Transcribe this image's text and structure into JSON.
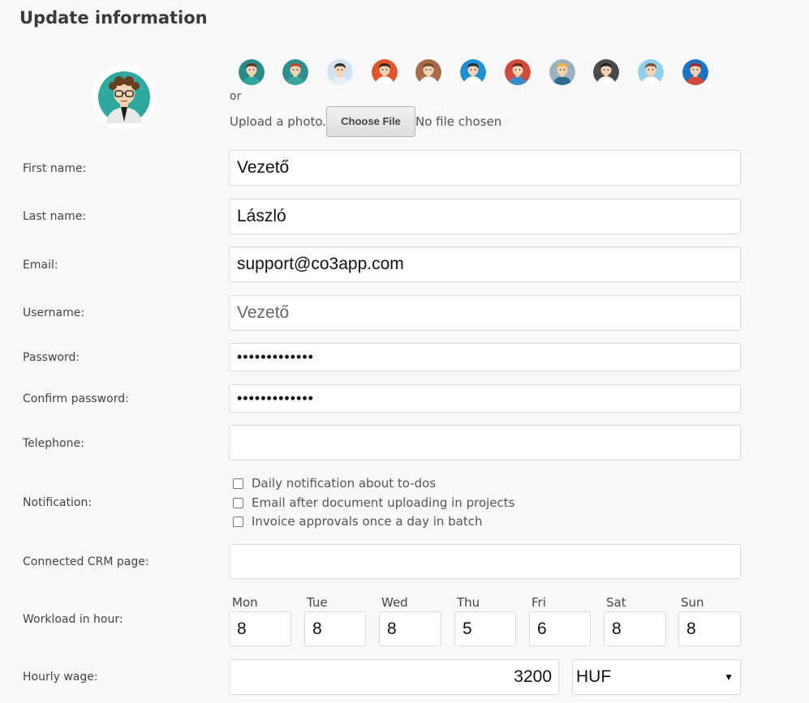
{
  "page": {
    "title": "Update information"
  },
  "avatars": {
    "current": "user-avatar",
    "options": [
      {
        "name": "avatar-man-glasses-teal",
        "bg": "#2a8a8a",
        "hair": "#5b3a1e",
        "shirt": "#2fa8a0"
      },
      {
        "name": "avatar-woman-redhead",
        "bg": "#2f8f8f",
        "hair": "#b8472c",
        "shirt": "#3aa59d"
      },
      {
        "name": "avatar-man-bald-beard",
        "bg": "#cfe3f3",
        "hair": "#2b2b2b",
        "shirt": "#e8eef4"
      },
      {
        "name": "avatar-man-red-bg",
        "bg": "#e0552e",
        "hair": "#3a2414",
        "shirt": "#ffffff"
      },
      {
        "name": "avatar-man-brown-bg",
        "bg": "#a76b4a",
        "hair": "#6a4a2e",
        "shirt": "#ffffff"
      },
      {
        "name": "avatar-man-blue-bg",
        "bg": "#1e8fd3",
        "hair": "#2a2a2a",
        "shirt": "#ffffff"
      },
      {
        "name": "avatar-woman-red-bg",
        "bg": "#d24a3a",
        "hair": "#6b2a16",
        "shirt": "#3a8cc9"
      },
      {
        "name": "avatar-woman-blonde",
        "bg": "#9ab2bf",
        "hair": "#f0b43a",
        "shirt": "#2c6d8f"
      },
      {
        "name": "avatar-man-dark-bg",
        "bg": "#4a4a4a",
        "hair": "#222222",
        "shirt": "#ffffff"
      },
      {
        "name": "avatar-man-lightblue-bg",
        "bg": "#8fd0ee",
        "hair": "#7a5232",
        "shirt": "#ffffff"
      },
      {
        "name": "avatar-woman-blue-bg",
        "bg": "#1d73c4",
        "hair": "#a5231f",
        "shirt": "#d34a3a"
      }
    ]
  },
  "photo": {
    "or_text": "or",
    "upload_label": "Upload a photo...",
    "choose_button": "Choose File",
    "no_file": "No file chosen"
  },
  "fields": {
    "first_name": {
      "label": "First name:",
      "value": "Vezető"
    },
    "last_name": {
      "label": "Last name:",
      "value": "László"
    },
    "email": {
      "label": "Email:",
      "value": "support@co3app.com"
    },
    "username": {
      "label": "Username:",
      "value": "Vezető"
    },
    "password": {
      "label": "Password:",
      "value": "•••••••••••••"
    },
    "confirm_password": {
      "label": "Confirm password:",
      "value": "•••••••••••••"
    },
    "telephone": {
      "label": "Telephone:",
      "value": ""
    },
    "crm_page": {
      "label": "Connected CRM page:",
      "value": ""
    }
  },
  "notification": {
    "label": "Notification:",
    "options": [
      {
        "label": "Daily notification about to-dos",
        "checked": false
      },
      {
        "label": "Email after document uploading in projects",
        "checked": false
      },
      {
        "label": "Invoice approvals once a day in batch",
        "checked": false
      }
    ]
  },
  "workload": {
    "label": "Workload in hour:",
    "days": [
      {
        "day": "Mon",
        "value": "8"
      },
      {
        "day": "Tue",
        "value": "8"
      },
      {
        "day": "Wed",
        "value": "8"
      },
      {
        "day": "Thu",
        "value": "5"
      },
      {
        "day": "Fri",
        "value": "6"
      },
      {
        "day": "Sat",
        "value": "8"
      },
      {
        "day": "Sun",
        "value": "8"
      }
    ]
  },
  "wage": {
    "label": "Hourly wage:",
    "value": "3200",
    "currency": "HUF"
  }
}
